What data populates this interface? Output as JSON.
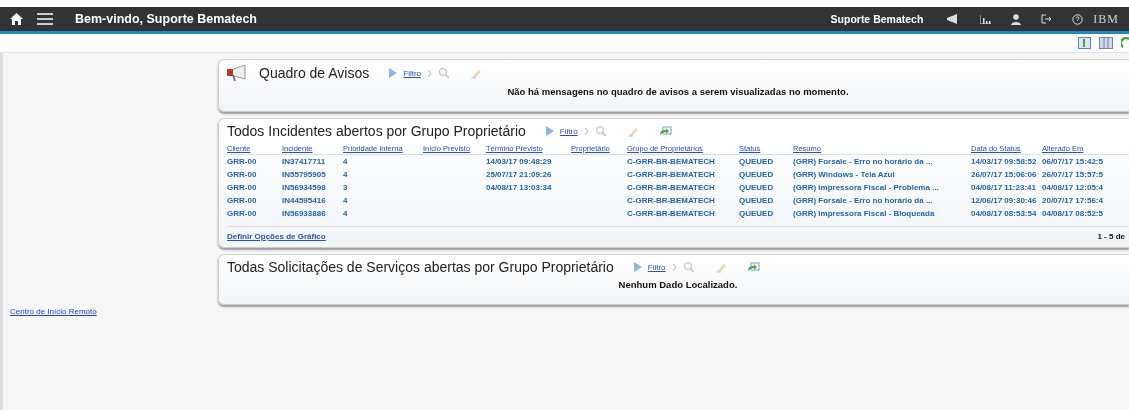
{
  "topbar": {
    "title": "Bem-vindo, Suporte Bematech",
    "user": "Suporte Bematech",
    "logo": "IBM"
  },
  "sidebar": {
    "link": "Centro de Início Remoto"
  },
  "panels": [
    {
      "kind": "message",
      "title": "Quadro de Avisos",
      "filter": "Filtro",
      "message": "Não há mensagens no quadro de avisos a serem visualizadas no momento."
    },
    {
      "kind": "table",
      "title": "Todos Incidentes abertos por Grupo Proprietário",
      "filter": "Filtro",
      "columns": [
        "Cliente",
        "Incidente",
        "Prioridade Interna",
        "Início Previsto",
        "Término Previsto",
        "Proprietário",
        "Grupo de Proprietários",
        "Status",
        "Resumo",
        "Data do Status",
        "Alterado Em"
      ],
      "rows": [
        [
          "GRR-00",
          "IN37417711",
          "4",
          null,
          "14/03/17 09:48:29",
          null,
          "C-GRR-BR-BEMATECH",
          "QUEUED",
          "(GRR) Forsale - Erro no horário da ...",
          "14/03/17 09:58:52",
          "06/07/17 15:42:5"
        ],
        [
          "GRR-00",
          "IN55795905",
          "4",
          null,
          "25/07/17 21:09:26",
          null,
          "C-GRR-BR-BEMATECH",
          "QUEUED",
          "(GRR) Windows - Tela Azul",
          "26/07/17 15:06:06",
          "26/07/17 15:57:5"
        ],
        [
          "GRR-00",
          "IN56934598",
          "3",
          null,
          "04/08/17 13:03:34",
          null,
          "C-GRR-BR-BEMATECH",
          "QUEUED",
          "(GRR) Impressora Fiscal - Problema ...",
          "04/08/17 11:23:41",
          "04/08/17 12:05:4"
        ],
        [
          "GRR-00",
          "IN44595416",
          "4",
          null,
          null,
          null,
          "C-GRR-BR-BEMATECH",
          "QUEUED",
          "(GRR) Forsale - Erro no horário da ...",
          "12/06/17 09:30:46",
          "20/07/17 17:56:4"
        ],
        [
          "GRR-00",
          "IN56933886",
          "4",
          null,
          null,
          null,
          "C-GRR-BR-BEMATECH",
          "QUEUED",
          "(GRR) Impressora Fiscal - Bloqueada",
          "04/08/17 08:53:54",
          "04/08/17 08:52:5"
        ]
      ],
      "footer_link": "Definir Opções de Gráfico",
      "pagination": "1 - 5 de"
    },
    {
      "kind": "message",
      "title": "Todas Solicitações de Serviços abertas por Grupo Proprietário",
      "filter": "Filtro",
      "message": "Nenhum Dado Localizado."
    }
  ]
}
